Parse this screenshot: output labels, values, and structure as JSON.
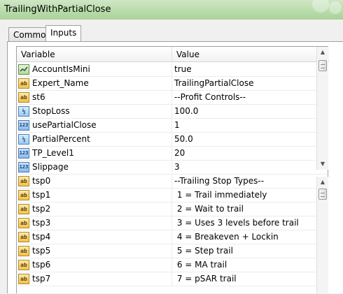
{
  "window": {
    "title": "TrailingWithPartialClose"
  },
  "tabs": [
    {
      "label": "Common",
      "active": false
    },
    {
      "label": "Inputs",
      "active": true
    }
  ],
  "grid": {
    "headers": {
      "variable": "Variable",
      "value": "Value"
    },
    "rows": [
      {
        "icon": "bool",
        "icon_text": "",
        "name": "AccountIsMini",
        "value": "true"
      },
      {
        "icon": "ab",
        "icon_text": "ab",
        "name": "Expert_Name",
        "value": "TrailingPartialClose"
      },
      {
        "icon": "ab",
        "icon_text": "ab",
        "name": "st6",
        "value": "--Profit Controls--"
      },
      {
        "icon": "frac",
        "icon_text": "½",
        "name": "StopLoss",
        "value": "100.0"
      },
      {
        "icon": "n123",
        "icon_text": "123",
        "name": "usePartialClose",
        "value": "1"
      },
      {
        "icon": "frac",
        "icon_text": "½",
        "name": "PartialPercent",
        "value": "50.0"
      },
      {
        "icon": "n123",
        "icon_text": "123",
        "name": "TP_Level1",
        "value": "20"
      },
      {
        "icon": "n123",
        "icon_text": "123",
        "name": "Slippage",
        "value": "3"
      },
      {
        "icon": "ab",
        "icon_text": "ab",
        "name": "tsp0",
        "value": "--Trailing Stop Types--"
      },
      {
        "icon": "ab",
        "icon_text": "ab",
        "name": "tsp1",
        "value": " 1 = Trail immediately"
      },
      {
        "icon": "ab",
        "icon_text": "ab",
        "name": "tsp2",
        "value": " 2 = Wait to trail"
      },
      {
        "icon": "ab",
        "icon_text": "ab",
        "name": "tsp3",
        "value": " 3 = Uses 3 levels before trail"
      },
      {
        "icon": "ab",
        "icon_text": "ab",
        "name": "tsp4",
        "value": " 4 = Breakeven + Lockin"
      },
      {
        "icon": "ab",
        "icon_text": "ab",
        "name": "tsp5",
        "value": " 5 = Step trail"
      },
      {
        "icon": "ab",
        "icon_text": "ab",
        "name": "tsp6",
        "value": " 6 = MA trail"
      },
      {
        "icon": "ab",
        "icon_text": "ab",
        "name": "tsp7",
        "value": " 7 = pSAR trail"
      }
    ]
  }
}
